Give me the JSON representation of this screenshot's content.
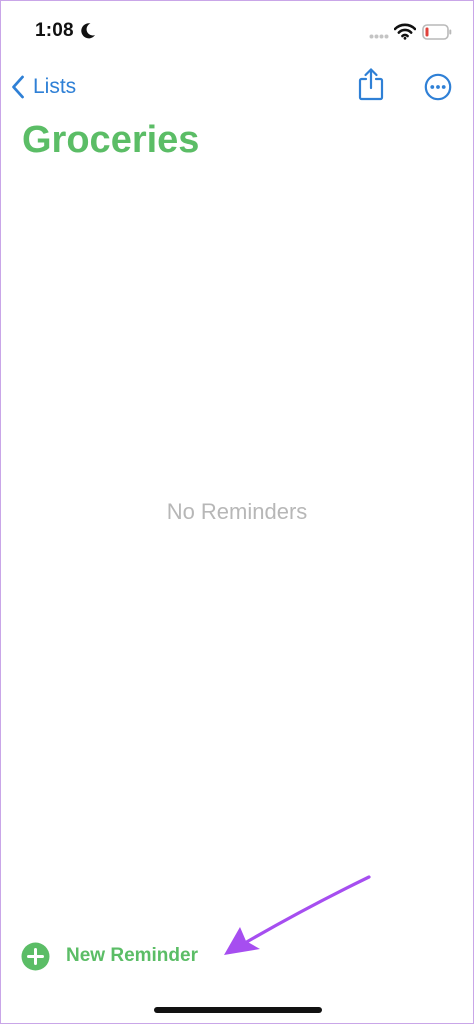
{
  "status_bar": {
    "time": "1:08",
    "icons": [
      "moon-icon",
      "signal-icon",
      "wifi-icon",
      "battery-icon"
    ],
    "battery_color": "#e0413b"
  },
  "nav": {
    "back_label": "Lists",
    "back_icon": "chevron-left-icon",
    "share_icon": "share-icon",
    "more_icon": "ellipsis-circle-icon",
    "accent_color": "#2f80d6"
  },
  "list": {
    "title": "Groceries",
    "title_color": "#5bbd66",
    "empty_message": "No Reminders"
  },
  "footer": {
    "new_reminder_label": "New Reminder",
    "new_reminder_icon": "plus-circle-icon"
  },
  "annotation": {
    "arrow_icon": "arrow-annotation-icon",
    "arrow_color": "#a64ef0"
  }
}
